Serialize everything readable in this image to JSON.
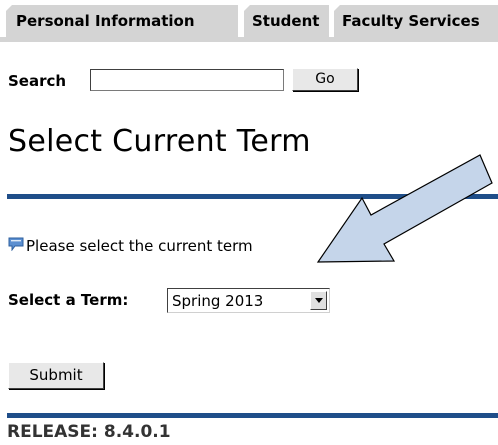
{
  "tabs": [
    {
      "label": "Personal Information"
    },
    {
      "label": "Student"
    },
    {
      "label": "Faculty Services"
    }
  ],
  "search": {
    "label": "Search",
    "value": "",
    "go_label": "Go"
  },
  "page": {
    "title": "Select Current Term"
  },
  "info": {
    "text": "Please select the current term",
    "icon": "info-comment-icon"
  },
  "term": {
    "label": "Select a Term:",
    "selected": "Spring 2013"
  },
  "submit": {
    "label": "Submit"
  },
  "footer": {
    "release": "RELEASE: 8.4.0.1"
  },
  "colors": {
    "rule": "#1f4e89",
    "tab_bg": "#d4d4d4",
    "annotation_arrow": "#c5d5ea"
  }
}
